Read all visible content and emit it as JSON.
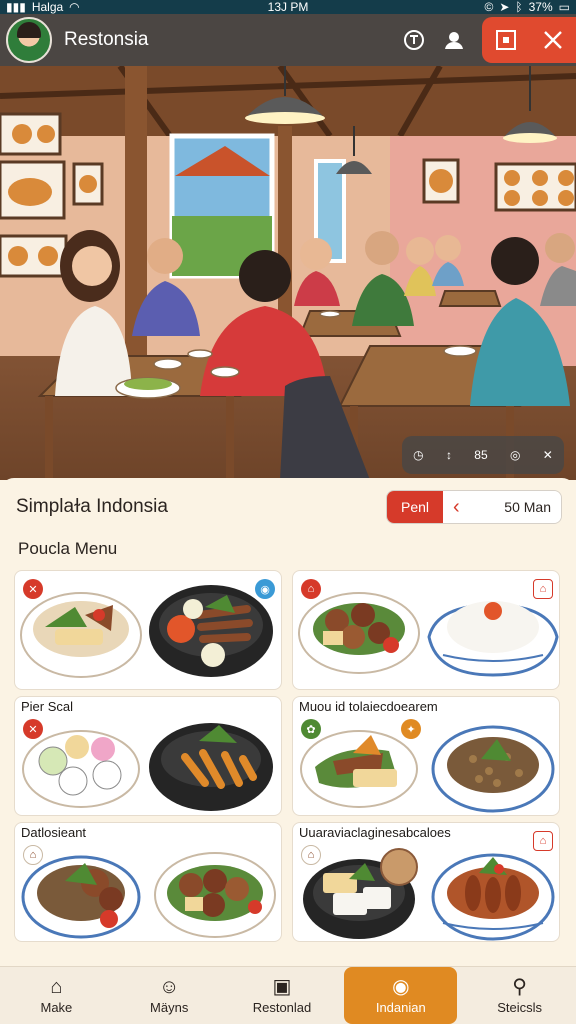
{
  "statusbar": {
    "carrier": "Halga",
    "time": "13J PM",
    "battery": "37%"
  },
  "appbar": {
    "title": "Restonsia",
    "icons": [
      "timer-icon",
      "profile-icon",
      "window-restore-icon",
      "close-icon"
    ]
  },
  "video_controls": {
    "value": "85",
    "icons": [
      "clock-icon",
      "vertical-arrows-icon",
      "target-icon",
      "cutlery-icon"
    ]
  },
  "section": {
    "title": "Simplaɫa Indonsia",
    "filter_label": "Penl",
    "filter_value": "50 Man"
  },
  "menu": {
    "title": "Poucla Menu",
    "cards": [
      {
        "label": ""
      },
      {
        "label": ""
      },
      {
        "label": "Pier Scal"
      },
      {
        "label": "Muou id tolaiecdoearem"
      },
      {
        "label": "Datlosieant"
      },
      {
        "label": "Uuaraviaclaginesabcaloes"
      }
    ]
  },
  "nav": {
    "items": [
      {
        "label": "Make",
        "icon": "home-icon"
      },
      {
        "label": "Mäyns",
        "icon": "face-icon"
      },
      {
        "label": "Restonlad",
        "icon": "bag-icon"
      },
      {
        "label": "Indanian",
        "icon": "chef-icon"
      },
      {
        "label": "Steicsls",
        "icon": "person-icon"
      }
    ],
    "active_index": 3
  },
  "colors": {
    "accent": "#e08a22",
    "alert_red": "#d63a2a",
    "appbar_bg": "#4b4643",
    "status_bg": "#143c4a"
  }
}
